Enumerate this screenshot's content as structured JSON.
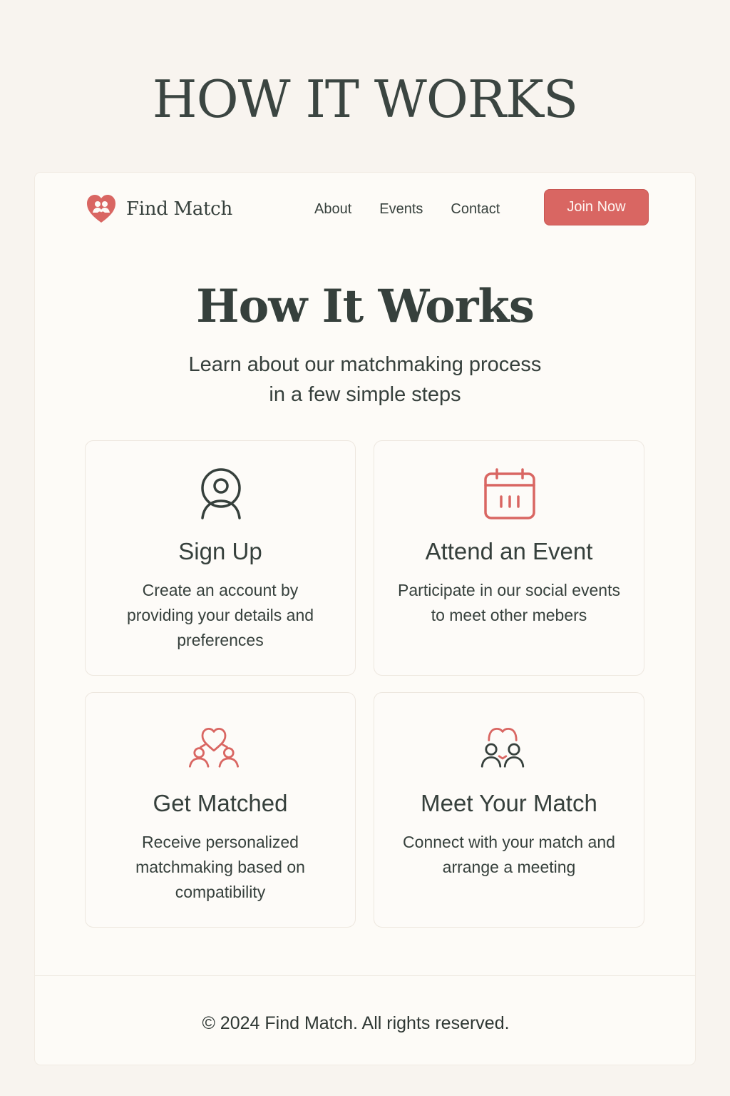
{
  "banner": {
    "title": "HOW IT WORKS"
  },
  "brand": {
    "name": "Find Match",
    "logo_icon": "heart-couple-logo",
    "accent_color": "#d96662"
  },
  "nav": {
    "items": [
      "About",
      "Events",
      "Contact"
    ],
    "join_label": "Join Now"
  },
  "hero": {
    "title": "How It Works",
    "subtitle_lines": [
      "Learn about our matchmaking process",
      "in a few simple steps"
    ]
  },
  "steps": [
    {
      "icon": "user-icon",
      "title": "Sign Up",
      "description": "Create an account by providing your details and preferences"
    },
    {
      "icon": "calendar-icon",
      "title": "Attend an Event",
      "description": "Participate in our social events to meet other mebers"
    },
    {
      "icon": "heart-match-icon",
      "title": "Get Matched",
      "description": "Receive personalized matchmaking based on compatibility"
    },
    {
      "icon": "couple-meet-icon",
      "title": "Meet Your Match",
      "description": "Connect with your match and arrange a meeting"
    }
  ],
  "footer": {
    "text": "© 2024 Find Match. All rights reserved."
  },
  "colors": {
    "accent": "#d96662",
    "text": "#36403c",
    "background": "#f8f4ef",
    "panel": "#fdfbf7"
  }
}
